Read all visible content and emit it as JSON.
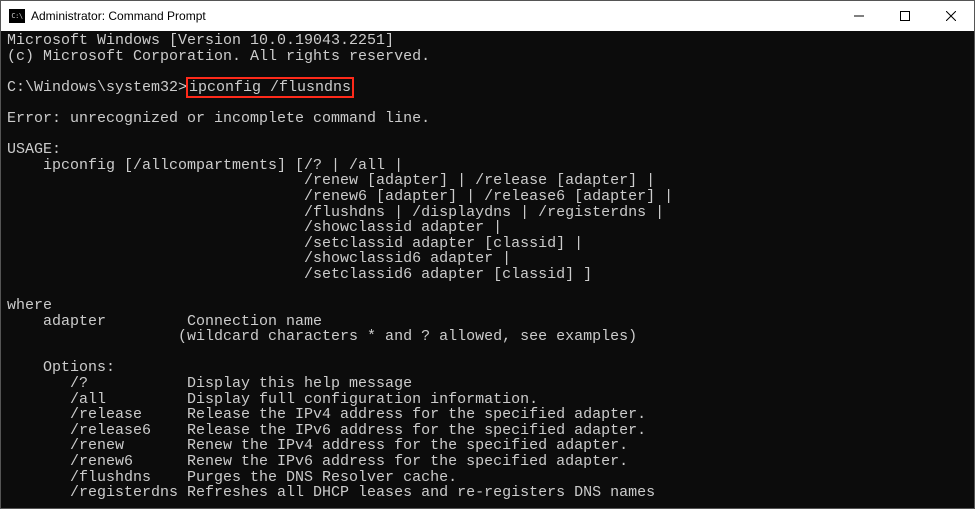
{
  "titlebar": {
    "title": "Administrator: Command Prompt"
  },
  "terminal": {
    "lines": [
      "Microsoft Windows [Version 10.0.19043.2251]",
      "(c) Microsoft Corporation. All rights reserved.",
      "",
      {
        "prompt": "C:\\Windows\\system32>",
        "cmd": "ipconfig /flusndns"
      },
      "",
      "Error: unrecognized or incomplete command line.",
      "",
      "USAGE:",
      "    ipconfig [/allcompartments] [/? | /all |",
      "                                 /renew [adapter] | /release [adapter] |",
      "                                 /renew6 [adapter] | /release6 [adapter] |",
      "                                 /flushdns | /displaydns | /registerdns |",
      "                                 /showclassid adapter |",
      "                                 /setclassid adapter [classid] |",
      "                                 /showclassid6 adapter |",
      "                                 /setclassid6 adapter [classid] ]",
      "",
      "where",
      "    adapter         Connection name",
      "                   (wildcard characters * and ? allowed, see examples)",
      "",
      "    Options:",
      "       /?           Display this help message",
      "       /all         Display full configuration information.",
      "       /release     Release the IPv4 address for the specified adapter.",
      "       /release6    Release the IPv6 address for the specified adapter.",
      "       /renew       Renew the IPv4 address for the specified adapter.",
      "       /renew6      Renew the IPv6 address for the specified adapter.",
      "       /flushdns    Purges the DNS Resolver cache.",
      "       /registerdns Refreshes all DHCP leases and re-registers DNS names"
    ]
  }
}
